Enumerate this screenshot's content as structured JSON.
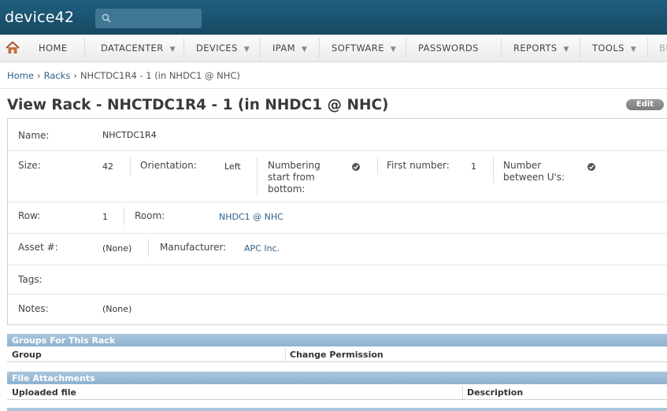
{
  "app": {
    "logo": "device42",
    "search_placeholder": ""
  },
  "nav": {
    "items": [
      {
        "label": "HOME",
        "caret": ""
      },
      {
        "label": "DATACENTER",
        "caret": "▼"
      },
      {
        "label": "DEVICES",
        "caret": "▼"
      },
      {
        "label": "IPAM",
        "caret": "▼"
      },
      {
        "label": "SOFTWARE",
        "caret": "▼"
      },
      {
        "label": "PASSWORDS",
        "caret": ""
      },
      {
        "label": "REPORTS",
        "caret": "▼"
      },
      {
        "label": "TOOLS",
        "caret": "▼"
      },
      {
        "label": "BU",
        "caret": ""
      }
    ]
  },
  "breadcrumb": {
    "home": "Home",
    "racks": "Racks",
    "current": "NHCTDC1R4 - 1 (in NHDC1 @ NHC)",
    "sep": "›"
  },
  "page": {
    "title": "View Rack - NHCTDC1R4 - 1 (in NHDC1 @ NHC)",
    "edit_label": "Edit"
  },
  "details": {
    "name_label": "Name:",
    "name_value": "NHCTDC1R4",
    "size_label": "Size:",
    "size_value": "42",
    "orientation_label": "Orientation:",
    "orientation_value": "Left",
    "numbering_label_1": "Numbering",
    "numbering_label_2": "start from",
    "numbering_label_3": "bottom:",
    "first_number_label": "First number:",
    "first_number_value": "1",
    "between_label_1": "Number",
    "between_label_2": "between U's:",
    "row_label": "Row:",
    "row_value": "1",
    "room_label": "Room:",
    "room_value": "NHDC1 @ NHC",
    "asset_label": "Asset #:",
    "asset_value": "(None)",
    "manufacturer_label": "Manufacturer:",
    "manufacturer_value": "APC Inc.",
    "tags_label": "Tags:",
    "notes_label": "Notes:",
    "notes_value": "(None)"
  },
  "groups": {
    "title": "Groups For This Rack",
    "col_group": "Group",
    "col_permission": "Change Permission"
  },
  "files": {
    "title": "File Attachments",
    "col_file": "Uploaded file",
    "col_desc": "Description"
  },
  "colors": {
    "header": "#1a5573",
    "section": "#9ebdd7",
    "link": "#2c5f8a"
  }
}
